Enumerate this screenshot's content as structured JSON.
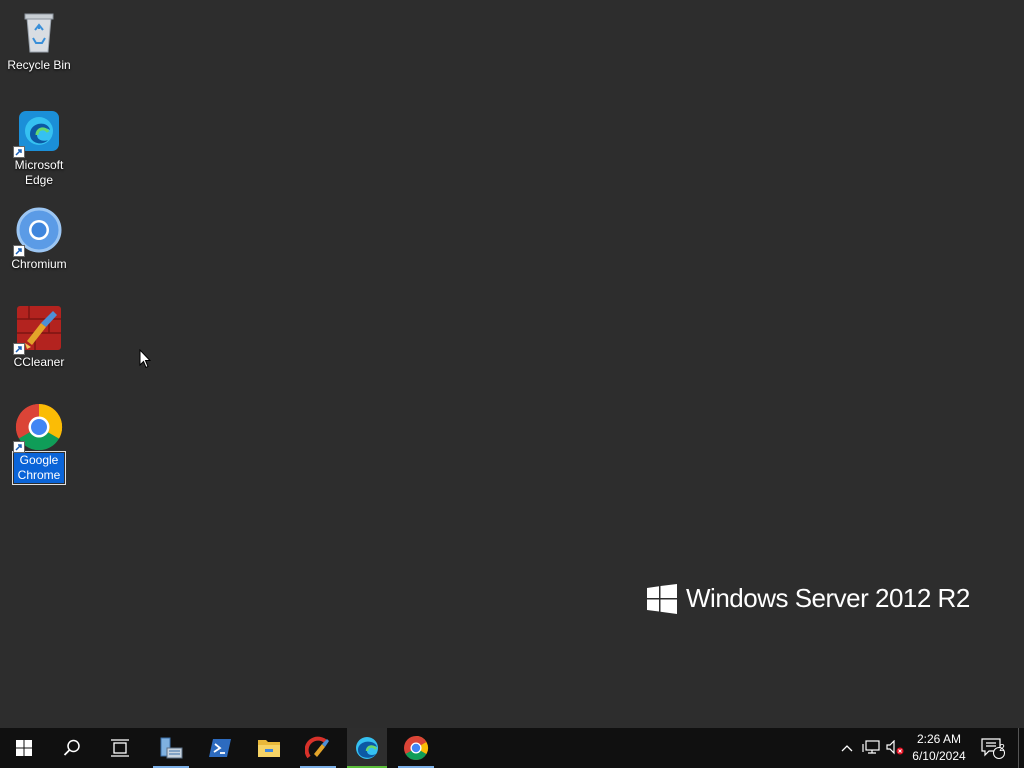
{
  "desktop": {
    "icons": [
      {
        "label": "Recycle Bin"
      },
      {
        "label": "Microsoft Edge"
      },
      {
        "label": "Chromium"
      },
      {
        "label": "CCleaner"
      },
      {
        "label": "Google Chrome"
      }
    ],
    "branding": "Windows Server 2012 R2"
  },
  "taskbar": {
    "clock": {
      "time": "2:26 AM",
      "date": "6/10/2024"
    },
    "notifications_count": "2",
    "pinned": [
      "start-icon",
      "search-icon",
      "task-view-icon",
      "server-manager-icon",
      "powershell-icon",
      "file-explorer-icon",
      "ccleaner-icon",
      "edge-icon",
      "chrome-icon"
    ]
  },
  "colors": {
    "desktop_bg": "#2d2d2d",
    "taskbar_bg": "#101010",
    "selection": "#0a64d8",
    "active_indicator": "#5bbf3a"
  }
}
